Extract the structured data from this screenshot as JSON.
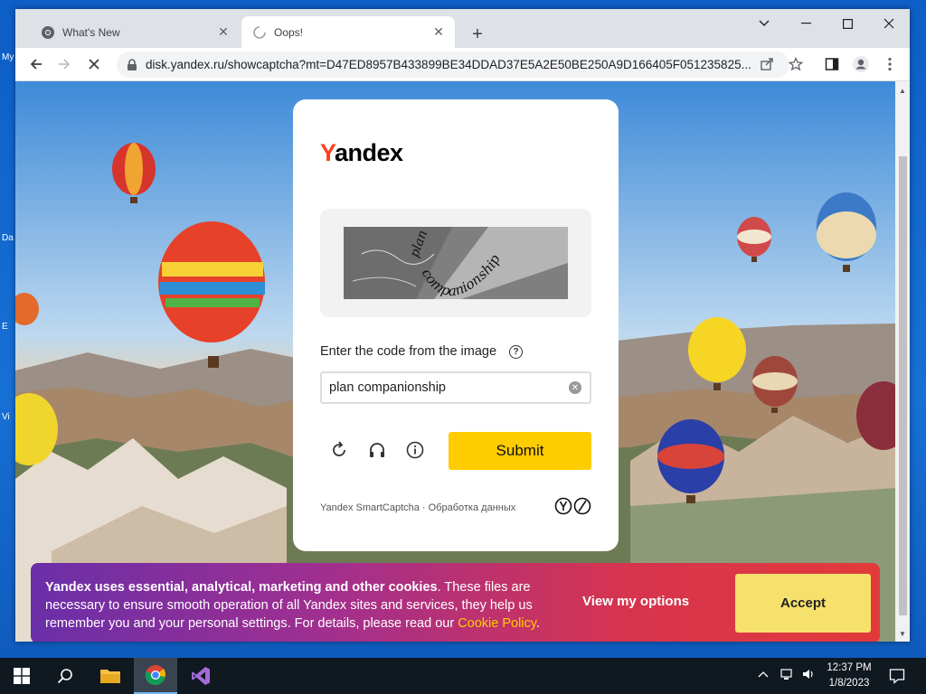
{
  "desktop": {
    "icon_labels": [
      "My",
      "Da",
      "E",
      "Vi"
    ]
  },
  "browser": {
    "tabs": [
      {
        "title": "What's New",
        "close": "✕",
        "favicon": "chrome-icon"
      },
      {
        "title": "Oops!",
        "close": "✕",
        "favicon": "loading-spinner-icon"
      }
    ],
    "new_tab_label": "+",
    "url": "disk.yandex.ru/showcaptcha?mt=D47ED8957B433899BE34DDAD37E5A2E50BE250A9D166405F051235825..."
  },
  "captcha": {
    "logo_first": "Y",
    "logo_rest": "andex",
    "captcha_text_line1": "plan",
    "captcha_text_line2": "companionship",
    "label": "Enter the code from the image",
    "help_glyph": "?",
    "input_value": "plan companionship",
    "clear_glyph": "✕",
    "submit_label": "Submit",
    "footer": "Yandex SmartCaptcha · Обработка данных"
  },
  "cookie_banner": {
    "bold_text": "Yandex uses essential, analytical, marketing and other cookies",
    "text": ". These files are necessary to ensure smooth operation of all Yandex sites and services, they help us remember you and your personal settings. For details, please read our ",
    "link_text": "Cookie Policy",
    "end_text": ".",
    "view_options_label": "View my options",
    "accept_label": "Accept"
  },
  "taskbar": {
    "time": "12:37 PM",
    "date": "1/8/2023"
  }
}
